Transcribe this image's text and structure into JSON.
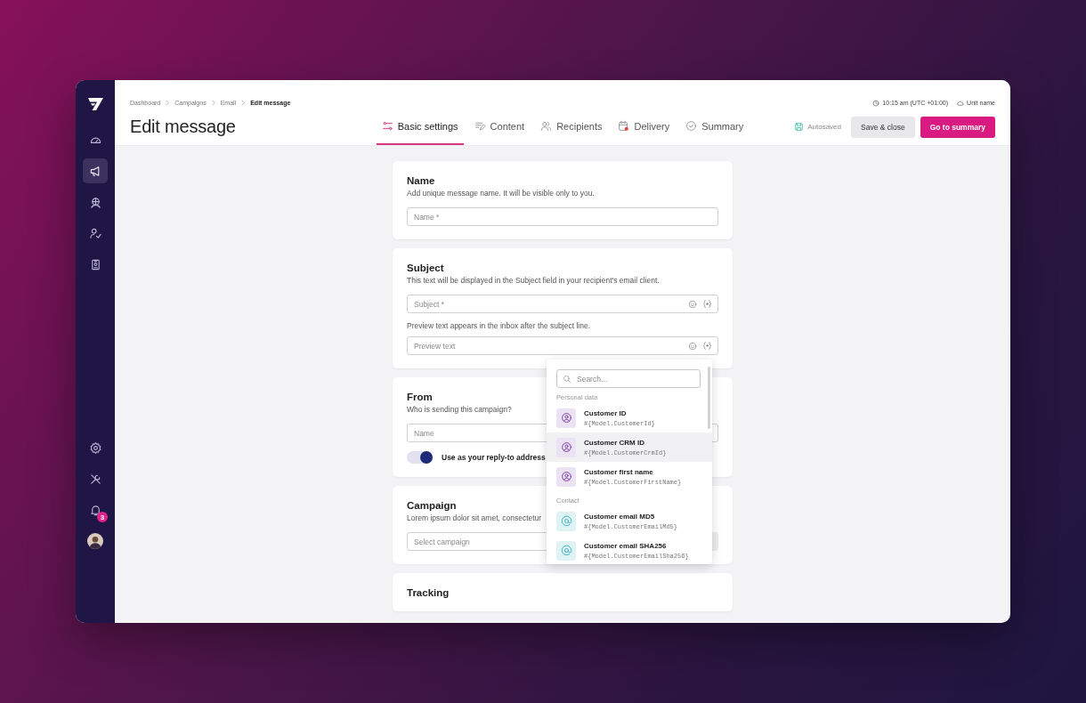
{
  "sidebar": {
    "nav_items": [
      {
        "kind": "gauge",
        "selected": false
      },
      {
        "kind": "megaphone",
        "selected": true
      },
      {
        "kind": "head",
        "selected": false
      },
      {
        "kind": "user-check",
        "selected": false
      },
      {
        "kind": "badge",
        "selected": false
      }
    ],
    "bottom_items": [
      {
        "kind": "settings"
      },
      {
        "kind": "tools"
      },
      {
        "kind": "bell",
        "badge": "3"
      },
      {
        "kind": "avatar"
      }
    ]
  },
  "header": {
    "breadcrumbs": [
      "Dashboard",
      "Campaigns",
      "Email",
      "Edit message"
    ],
    "clock": "10:15 am (UTC +01:00)",
    "unit": "Unit name",
    "title": "Edit message",
    "tabs": [
      {
        "kind": "settings",
        "label": "Basic settings",
        "selected": true
      },
      {
        "kind": "content",
        "label": "Content",
        "selected": false
      },
      {
        "kind": "recipients",
        "label": "Recipients",
        "selected": false
      },
      {
        "kind": "delivery",
        "label": "Delivery",
        "selected": false
      },
      {
        "kind": "summary",
        "label": "Summary",
        "selected": false
      }
    ],
    "autosave": "Autosaved",
    "buttons": [
      {
        "kind": "secondary",
        "label": "Save & close"
      },
      {
        "kind": "primary",
        "label": "Go to summary"
      }
    ]
  },
  "cards": [
    {
      "title": "Name",
      "description": "Add unique message name. It will be visible only to you.",
      "fields": [
        {
          "kind": "plain",
          "placeholder": "Name *"
        }
      ]
    },
    {
      "title": "Subject",
      "description": "This text will be displayed in the Subject field in your recipient's email client.",
      "fields": [
        {
          "kind": "rich",
          "placeholder": "Subject *"
        },
        {
          "kind": "rich",
          "hint": "Preview text appears in the inbox after the subject line.",
          "placeholder": "Preview text"
        }
      ]
    },
    {
      "title": "From",
      "description": "Who is sending this campaign?",
      "fields": [
        {
          "kind": "plain",
          "placeholder": "Name"
        }
      ],
      "toggle": {
        "label": "Use as your reply-to address",
        "on": true
      }
    },
    {
      "title": "Campaign",
      "description": "Lorem ipsum dolor sit amet, consectetur",
      "fields": [
        {
          "kind": "select",
          "placeholder": "Select campaign"
        }
      ]
    },
    {
      "title": "Tracking"
    }
  ],
  "dropdown": {
    "search_placeholder": "Search...",
    "groups": [
      {
        "label": "Personal data",
        "items": [
          {
            "kind": "person",
            "label": "Customer ID",
            "code": "#{Model.CustomerId}",
            "selected": false
          },
          {
            "kind": "person",
            "label": "Customer CRM ID",
            "code": "#{Model.CustomerCrmId}",
            "selected": true
          },
          {
            "kind": "person",
            "label": "Customer first name",
            "code": "#{Model.CustomerFirstName}",
            "selected": false
          }
        ]
      },
      {
        "label": "Contact",
        "items": [
          {
            "kind": "contact",
            "label": "Customer email MD5",
            "code": "#{Model.CustomerEmailMd5}",
            "selected": false
          },
          {
            "kind": "contact",
            "label": "Customer email SHA256",
            "code": "#{Model.CustomerEmailSha256}",
            "selected": false
          }
        ]
      }
    ]
  }
}
